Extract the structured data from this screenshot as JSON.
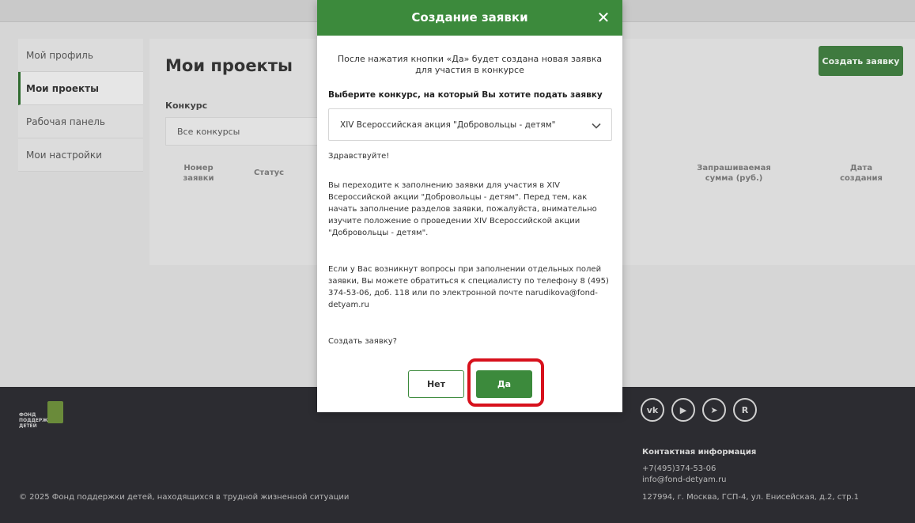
{
  "sidebar": {
    "items": [
      {
        "label": "Мой профиль"
      },
      {
        "label": "Мои проекты"
      },
      {
        "label": "Рабочая панель"
      },
      {
        "label": "Мои настройки"
      }
    ]
  },
  "main": {
    "title": "Мои проекты",
    "create_button": "Создать заявку",
    "contest_label": "Конкурс",
    "contest_select_value": "Все конкурсы",
    "table_headers": [
      "Номер заявки",
      "Статус",
      "Запрашиваемая сумма (руб.)",
      "Дата создания"
    ]
  },
  "modal": {
    "title": "Создание заявки",
    "close_symbol": "✕",
    "intro": "После нажатия кнопки «Да» будет создана новая заявка для участия в конкурсе",
    "prompt": "Выберите конкурс, на который Вы хотите подать заявку",
    "selected_contest": "XIV Всероссийская акция \"Добровольцы - детям\"",
    "greeting": "Здравствуйте!",
    "paragraph1": "Вы переходите к заполнению заявки для участия в XIV Всероссийской акции \"Добровольцы - детям\". Перед тем, как начать заполнение разделов заявки, пожалуйста, внимательно изучите положение о проведении XIV Всероссийской акции \"Добровольцы - детям\".",
    "paragraph2": "Если у Вас возникнут вопросы при заполнении отдельных полей заявки, Вы можете обратиться к специалисту по телефону 8 (495) 374-53-06, доб. 118 или по электронной почте narudikova@fond-detyam.ru",
    "question": "Создать заявку?",
    "no_label": "Нет",
    "yes_label": "Да"
  },
  "footer": {
    "logo_text": "ФОНД ПОДДЕРЖКИ ДЕТЕЙ",
    "copyright": "© 2025 Фонд поддержки детей, находящихся в трудной жизненной ситуации",
    "socials": [
      {
        "icon": "vk-icon",
        "glyph": "vk"
      },
      {
        "icon": "youtube-icon",
        "glyph": "▶"
      },
      {
        "icon": "telegram-icon",
        "glyph": "➤"
      },
      {
        "icon": "rutube-icon",
        "glyph": "R"
      }
    ],
    "contacts_title": "Контактная информация",
    "phone": "+7(495)374-53-06",
    "email": "info@fond-detyam.ru",
    "address": "127994, г. Москва, ГСП-4, ул. Енисейская, д.2, стр.1"
  },
  "colors": {
    "primary_green": "#3c8a3c",
    "highlight_red": "#d7111c",
    "footer_bg": "#2c2c31"
  }
}
